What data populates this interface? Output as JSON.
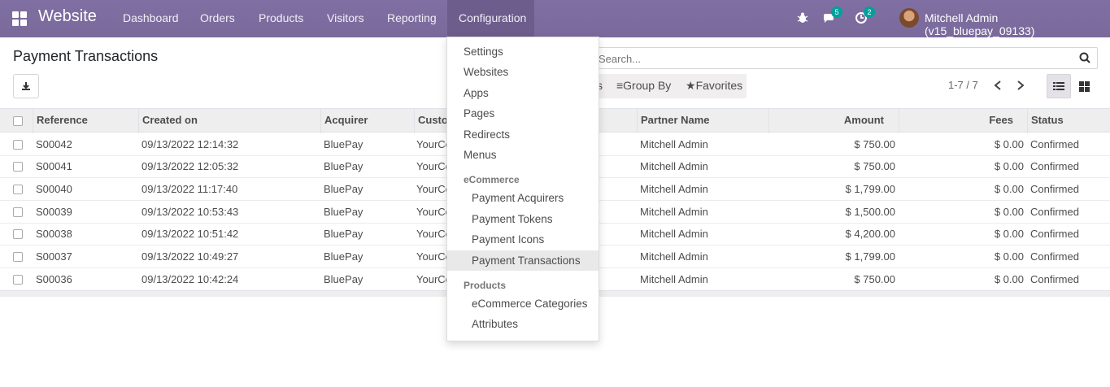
{
  "navbar": {
    "brand": "Website",
    "menu": [
      "Dashboard",
      "Orders",
      "Products",
      "Visitors",
      "Reporting",
      "Configuration"
    ],
    "messages_badge": "5",
    "activities_badge": "2",
    "user": "Mitchell Admin (v15_bluepay_09133)",
    "accent_color": "#7c6d9e"
  },
  "page": {
    "title": "Payment Transactions",
    "search_placeholder": "Search...",
    "filters_partial": "s",
    "group_by": "Group By",
    "favorites": "Favorites",
    "pager": "1-7 / 7"
  },
  "table": {
    "columns": [
      "Reference",
      "Created on",
      "Acquirer",
      "Custo",
      "Partner Name",
      "Amount",
      "Fees",
      "Status"
    ],
    "rows": [
      {
        "reference": "S00042",
        "created": "09/13/2022 12:14:32",
        "acquirer": "BluePay",
        "customer": "YourCo",
        "partner": "Mitchell Admin",
        "amount": "$ 750.00",
        "fees": "$ 0.00",
        "status": "Confirmed"
      },
      {
        "reference": "S00041",
        "created": "09/13/2022 12:05:32",
        "acquirer": "BluePay",
        "customer": "YourCo",
        "partner": "Mitchell Admin",
        "amount": "$ 750.00",
        "fees": "$ 0.00",
        "status": "Confirmed"
      },
      {
        "reference": "S00040",
        "created": "09/13/2022 11:17:40",
        "acquirer": "BluePay",
        "customer": "YourCo",
        "partner": "Mitchell Admin",
        "amount": "$ 1,799.00",
        "fees": "$ 0.00",
        "status": "Confirmed"
      },
      {
        "reference": "S00039",
        "created": "09/13/2022 10:53:43",
        "acquirer": "BluePay",
        "customer": "YourCo",
        "partner": "Mitchell Admin",
        "amount": "$ 1,500.00",
        "fees": "$ 0.00",
        "status": "Confirmed"
      },
      {
        "reference": "S00038",
        "created": "09/13/2022 10:51:42",
        "acquirer": "BluePay",
        "customer": "YourCo",
        "partner": "Mitchell Admin",
        "amount": "$ 4,200.00",
        "fees": "$ 0.00",
        "status": "Confirmed"
      },
      {
        "reference": "S00037",
        "created": "09/13/2022 10:49:27",
        "acquirer": "BluePay",
        "customer": "YourCo",
        "partner": "Mitchell Admin",
        "amount": "$ 1,799.00",
        "fees": "$ 0.00",
        "status": "Confirmed"
      },
      {
        "reference": "S00036",
        "created": "09/13/2022 10:42:24",
        "acquirer": "BluePay",
        "customer": "YourCo",
        "partner": "Mitchell Admin",
        "amount": "$ 750.00",
        "fees": "$ 0.00",
        "status": "Confirmed"
      }
    ]
  },
  "dropdown": {
    "items": [
      "Settings",
      "Websites",
      "Apps",
      "Pages",
      "Redirects",
      "Menus"
    ],
    "ecommerce_header": "eCommerce",
    "ecommerce_items": [
      "Payment Acquirers",
      "Payment Tokens",
      "Payment Icons",
      "Payment Transactions"
    ],
    "products_header": "Products",
    "products_items": [
      "eCommerce Categories",
      "Attributes"
    ],
    "selected": "Payment Transactions"
  }
}
